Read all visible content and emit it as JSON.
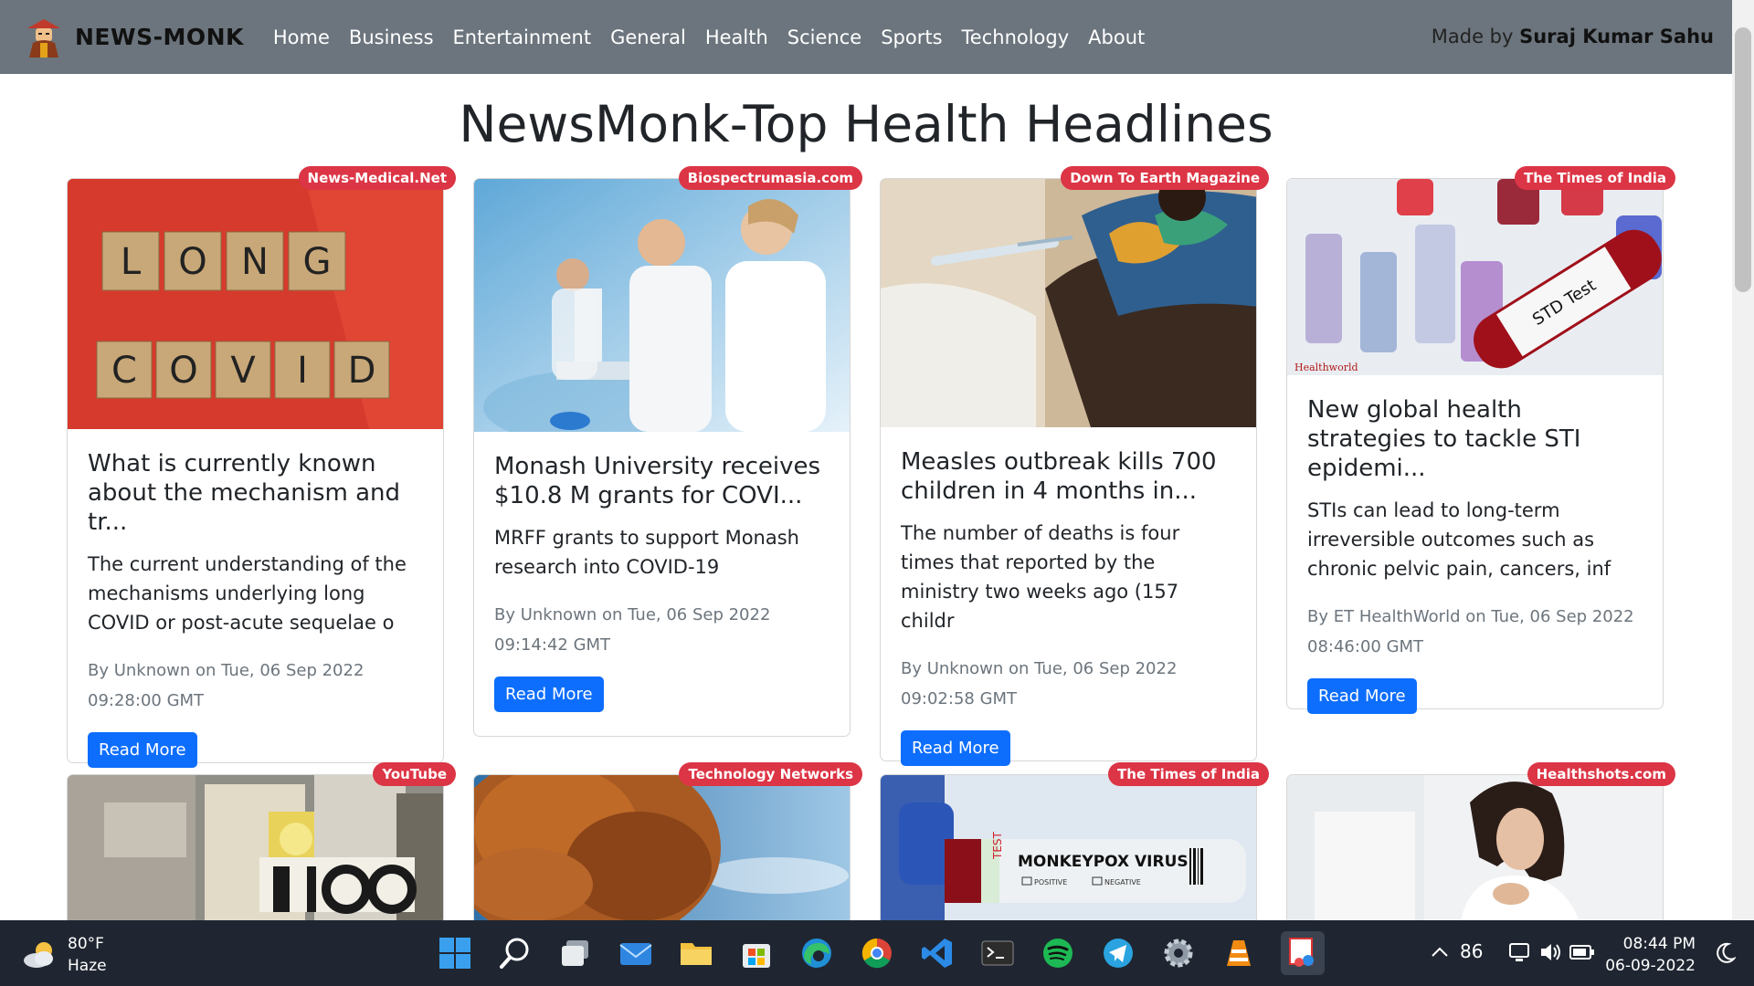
{
  "navbar": {
    "brand": "NEWS-MONK",
    "links": [
      "Home",
      "Business",
      "Entertainment",
      "General",
      "Health",
      "Science",
      "Sports",
      "Technology",
      "About"
    ],
    "made_by_prefix": "Made by",
    "made_by_name": "Suraj Kumar Sahu"
  },
  "heading": "NewsMonk-Top Health Headlines",
  "cards": [
    {
      "source": "News-Medical.Net",
      "title": "What is currently known about the mechanism and tr...",
      "description": "The current understanding of the mechanisms underlying long COVID or post-acute sequelae o",
      "meta": "By Unknown on Tue, 06 Sep 2022 09:28:00 GMT",
      "button": "Read More",
      "image_words": [
        "L",
        "O",
        "N",
        "G",
        "C",
        "O",
        "V",
        "I",
        "D"
      ]
    },
    {
      "source": "Biospectrumasia.com",
      "title": "Monash University receives $10.8 M grants for COVI...",
      "description": "MRFF grants to support Monash research into COVID-19",
      "meta": "By Unknown on Tue, 06 Sep 2022 09:14:42 GMT",
      "button": "Read More"
    },
    {
      "source": "Down To Earth Magazine",
      "title": "Measles outbreak kills 700 children in 4 months in...",
      "description": "The number of deaths is four times that reported by the ministry two weeks ago (157 childr",
      "meta": "By Unknown on Tue, 06 Sep 2022 09:02:58 GMT",
      "button": "Read More"
    },
    {
      "source": "The Times of India",
      "title": "New global health strategies to tackle STI epidemi...",
      "description": "STIs can lead to long-term irreversible outcomes such as chronic pelvic pain, cancers, inf",
      "meta": "By ET HealthWorld on Tue, 06 Sep 2022 08:46:00 GMT",
      "button": "Read More",
      "image_label": "STD Test",
      "image_watermark": "Healthworld"
    }
  ],
  "second_row": [
    {
      "source": "YouTube"
    },
    {
      "source": "Technology Networks"
    },
    {
      "source": "The Times of India",
      "image_label": "MONKEYPOX VIRUS",
      "image_sub1": "POSITIVE",
      "image_sub2": "NEGATIVE",
      "image_tag": "TEST"
    },
    {
      "source": "Healthshots.com"
    }
  ],
  "taskbar": {
    "weather_temp": "80°F",
    "weather_desc": "Haze",
    "tray_number": "86",
    "time": "08:44 PM",
    "date": "06-09-2022"
  }
}
